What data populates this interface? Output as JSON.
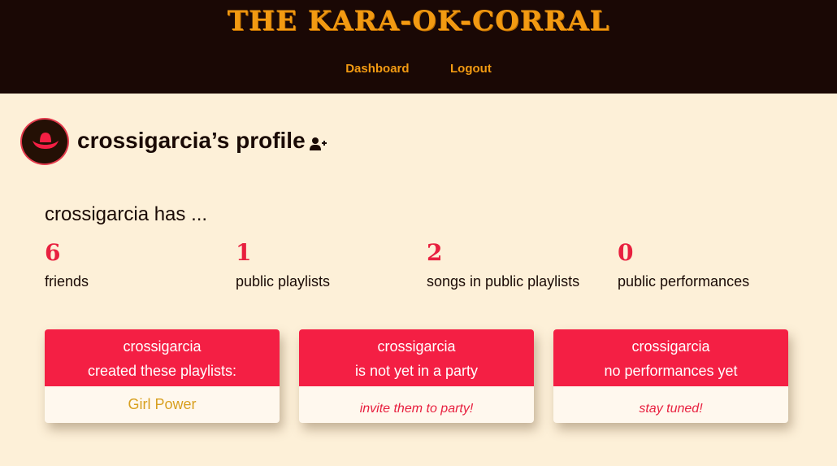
{
  "header": {
    "site_title": "THE KARA-OK-CORRAL",
    "nav": [
      "Dashboard",
      "Logout"
    ]
  },
  "profile": {
    "title": "crossigarcia’s profile",
    "has_text": "crossigarcia has ...",
    "avatar_icon": "cowboy-hat-icon",
    "add_friend_icon": "add-friend-icon"
  },
  "stats": [
    {
      "value": "6",
      "label": "friends"
    },
    {
      "value": "1",
      "label": "public playlists"
    },
    {
      "value": "2",
      "label": "songs in public playlists"
    },
    {
      "value": "0",
      "label": "public performances"
    }
  ],
  "cards": [
    {
      "line1": "crossigarcia",
      "line2": "created these playlists:",
      "body": "Girl Power"
    },
    {
      "line1": "crossigarcia",
      "line2": "is not yet in a party",
      "body": "invite them to party!"
    },
    {
      "line1": "crossigarcia",
      "line2": "no performances yet",
      "body": "stay tuned!"
    }
  ],
  "colors": {
    "header_bg": "#1a0805",
    "title_orange": "#f29a12",
    "page_bg": "#fdf0d8",
    "accent_red": "#f41f44",
    "playlist_gold": "#d8a020"
  }
}
